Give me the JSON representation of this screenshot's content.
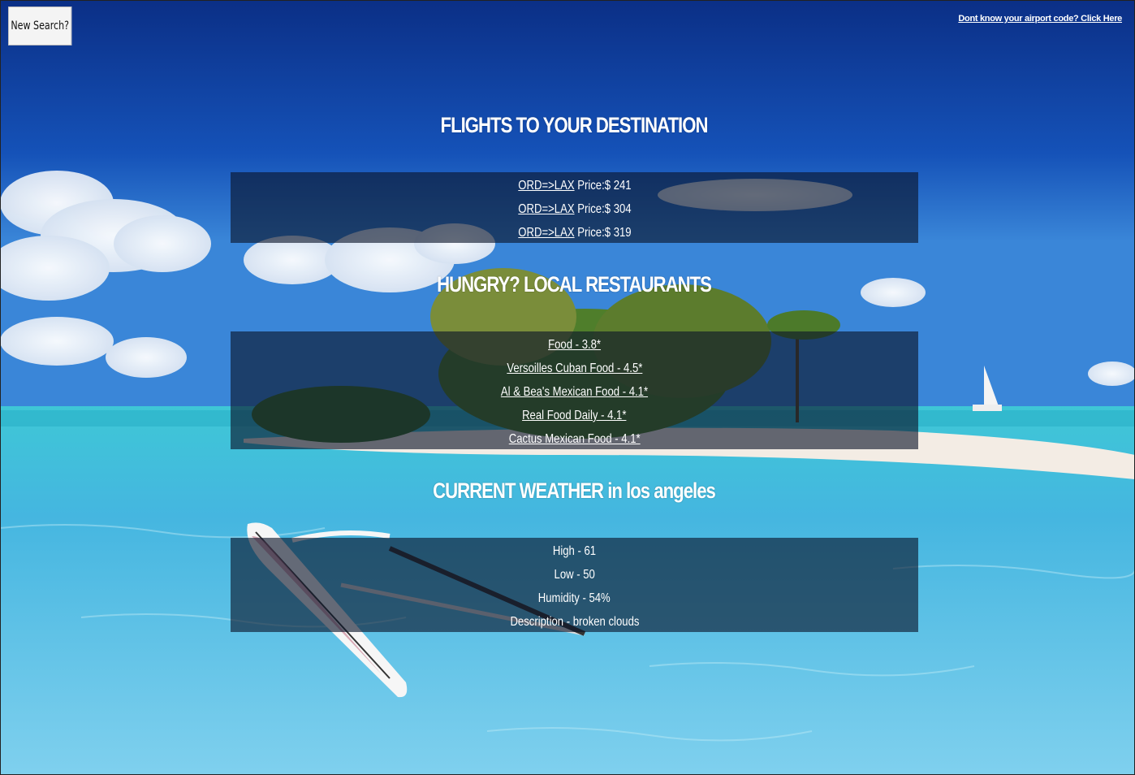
{
  "nav": {
    "new_search_label": "New Search?",
    "airport_code_link": "Dont know your airport code? Click Here"
  },
  "flights": {
    "heading": "FLIGHTS TO YOUR DESTINATION",
    "items": [
      {
        "route": "ORD=>LAX",
        "price": "Price:$ 241"
      },
      {
        "route": "ORD=>LAX",
        "price": "Price:$ 304"
      },
      {
        "route": "ORD=>LAX",
        "price": "Price:$ 319"
      }
    ]
  },
  "restaurants": {
    "heading": "HUNGRY? LOCAL RESTAURANTS",
    "items": [
      "Food - 3.8*",
      "Versoilles Cuban Food - 4.5*",
      "Al & Bea's Mexican Food - 4.1*",
      "Real Food Daily - 4.1*",
      "Cactus Mexican Food - 4.1*"
    ]
  },
  "weather": {
    "heading": "CURRENT WEATHER in los angeles",
    "items": [
      "High - 61",
      "Low - 50",
      "Humidity - 54%",
      "Description - broken clouds"
    ]
  }
}
